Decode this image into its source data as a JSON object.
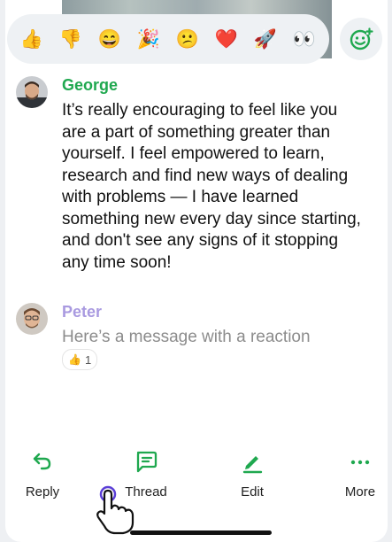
{
  "reactions": [
    {
      "icon": "thumbs-up-icon",
      "glyph": "👍"
    },
    {
      "icon": "thumbs-down-icon",
      "glyph": "👎"
    },
    {
      "icon": "grinning-face-icon",
      "glyph": "😄"
    },
    {
      "icon": "party-popper-icon",
      "glyph": "🎉"
    },
    {
      "icon": "confused-face-icon",
      "glyph": "😕"
    },
    {
      "icon": "heart-icon",
      "glyph": "❤️"
    },
    {
      "icon": "rocket-icon",
      "glyph": "🚀"
    },
    {
      "icon": "eyes-icon",
      "glyph": "👀"
    }
  ],
  "add_reaction_icon": "add-emoji-icon",
  "messages": [
    {
      "author": "George",
      "author_color": "#1fa84f",
      "text": "It’s really encouraging to feel like you are a part of something greater than yourself. I feel empowered to learn, research and find new ways of dealing with problems — I have learned something new every day since starting, and don't see any signs of it stopping any time soon!"
    },
    {
      "author": "Peter",
      "author_color": "#a99ae0",
      "text": "Here’s a message with a reaction",
      "reaction": {
        "glyph": "👍",
        "count": "1"
      }
    }
  ],
  "actions": {
    "reply": "Reply",
    "thread": "Thread",
    "edit": "Edit",
    "more": "More"
  },
  "colors": {
    "accent": "#1fa84f"
  }
}
